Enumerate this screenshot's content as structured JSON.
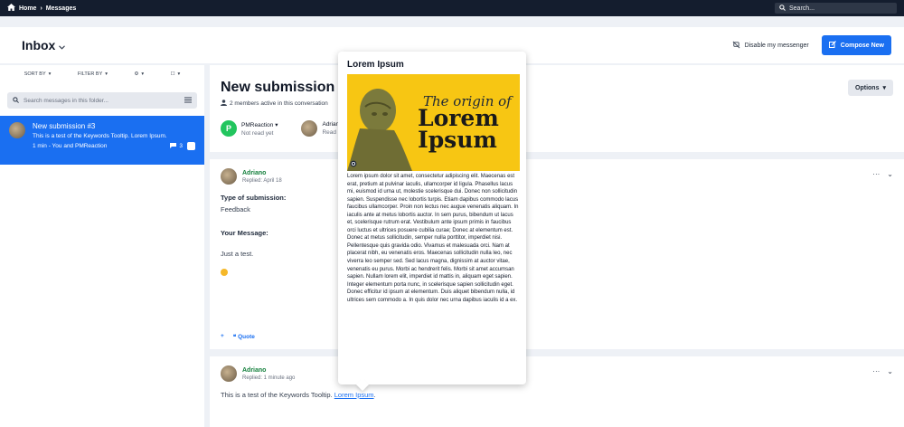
{
  "topbar": {
    "home": "Home",
    "separator": "›",
    "current": "Messages",
    "search_placeholder": "Search..."
  },
  "header": {
    "inbox_title": "Inbox",
    "disable_label": "Disable my messenger",
    "compose_label": "Compose New"
  },
  "sidebar": {
    "sort_by": "SORT BY",
    "filter_by": "FILTER BY",
    "search_placeholder": "Search messages in this folder...",
    "conversation": {
      "title": "New submission #3",
      "snippet": "This is a test of the Keywords Tooltip. Lorem Ipsum.",
      "meta": "1 min - You and PMReaction",
      "count": "3"
    }
  },
  "conversation": {
    "title": "New submission #3",
    "members": "2 members active in this conversation",
    "options_label": "Options",
    "participants": [
      {
        "initial": "P",
        "name": "PMReaction",
        "status": "Not read yet"
      },
      {
        "name": "Adriano",
        "status": "Read"
      }
    ]
  },
  "messages": [
    {
      "author": "Adriano",
      "replied": "Replied: April 18",
      "type_label": "Type of submission:",
      "type_value": "Feedback",
      "message_label": "Your Message:",
      "message_value": "Just a test.",
      "quote_plus": "+",
      "quote_label": "Quote"
    },
    {
      "author": "Adriano",
      "replied": "Replied: 1 minute ago",
      "text": "This is a test of the Keywords Tooltip. ",
      "link": "Lorem Ipsum",
      "text_end": "."
    }
  ],
  "tooltip": {
    "title": "Lorem Ipsum",
    "image_subtitle": "The origin of",
    "image_line1": "Lorem",
    "image_line2": "Ipsum",
    "body": "Lorem ipsum dolor sit amet, consectetur adipiscing elit. Maecenas est erat, pretium at pulvinar iaculis, ullamcorper id ligula. Phasellus lacus mi, euismod id urna ut, molestie scelerisque dui. Donec non sollicitudin sapien. Suspendisse nec lobortis turpis. Etiam dapibus commodo lacus faucibus ullamcorper. Proin non lectus nec augue venenatis aliquam. In iaculis ante at metus lobortis auctor. In sem purus, bibendum ut lacus et, scelerisque rutrum erat. Vestibulum ante ipsum primis in faucibus orci luctus et ultrices posuere cubilia curae; Donec at elementum est. Donec at metus sollicitudin, semper nulla porttitor, imperdiet nisi. Pellentesque quis gravida odio. Vivamus et malesuada orci. Nam at placerat nibh, eu venenatis eros. Maecenas sollicitudin nulla leo, nec viverra leo semper sed. Sed lacus magna, dignissim at auctor vitae, venenatis eu purus. Morbi ac hendrerit felis. Morbi sit amet accumsan sapien. Nullam lorem elit, imperdiet id mattis in, aliquam eget sapien. Integer elementum porta nunc, in scelerisque sapien sollicitudin eget. Donec efficitur id ipsum at elementum. Duis aliquet bibendum nulla, id ultrices sem commodo a. In quis dolor nec urna dapibus iaculis id a ex."
  },
  "colors": {
    "topbar": "#141d2e",
    "accent": "#1a6ff1",
    "author": "#15803d",
    "tooltip_image": "#f7c613"
  }
}
